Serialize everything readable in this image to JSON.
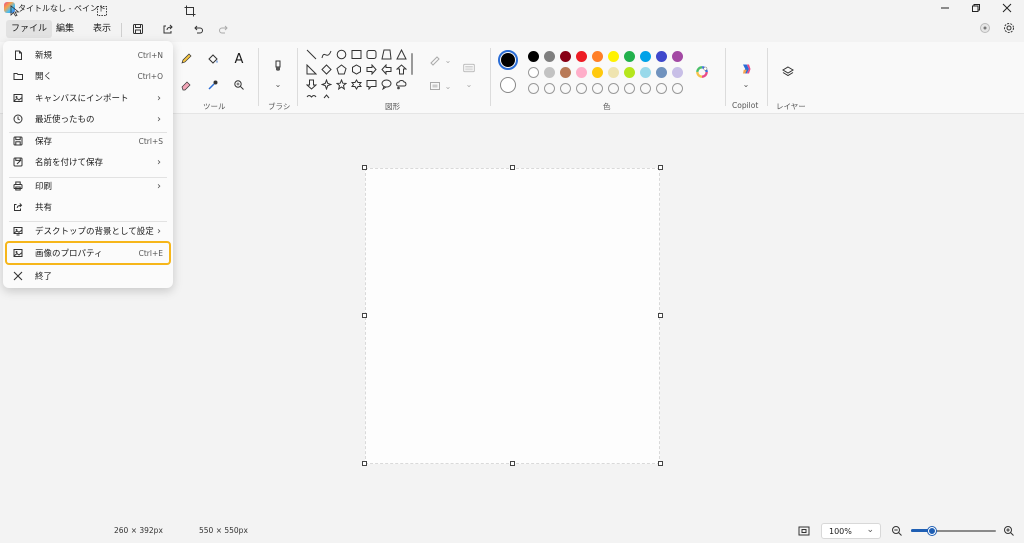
{
  "window": {
    "title": "タイトルなし - ペイント"
  },
  "menubar": {
    "items": [
      {
        "label": "ファイル"
      },
      {
        "label": "編集"
      },
      {
        "label": "表示"
      }
    ]
  },
  "ribbon": {
    "tools_label": "ツール",
    "brush_label": "ブラシ",
    "shapes_label": "図形",
    "colors_label": "色",
    "copilot_label": "Copilot",
    "layers_label": "レイヤー",
    "text_tool": "A",
    "palette": [
      "#000000",
      "#7f7f7f",
      "#880015",
      "#ed1c24",
      "#ff7f27",
      "#fff200",
      "#22b14c",
      "#00a2e8",
      "#3f48cc",
      "#a349a4",
      "#ffffff",
      "#c3c3c3",
      "#b97a57",
      "#ffaec9",
      "#ffc90e",
      "#efe4b0",
      "#b5e61d",
      "#99d9ea",
      "#7092be",
      "#c8bfe7",
      "empty",
      "empty",
      "empty",
      "empty",
      "empty",
      "empty",
      "empty",
      "empty",
      "empty",
      "empty"
    ],
    "primary_color": "#000000",
    "secondary_color": "#ffffff"
  },
  "file_menu": {
    "items": [
      {
        "label": "新規",
        "shortcut": "Ctrl+N",
        "icon": "new-file-icon"
      },
      {
        "label": "開く",
        "shortcut": "Ctrl+O",
        "icon": "folder-icon"
      },
      {
        "label": "キャンバスにインポート",
        "chevron": "›",
        "icon": "import-image-icon"
      },
      {
        "label": "最近使ったもの",
        "chevron": "›",
        "icon": "clock-icon"
      },
      {
        "label": "保存",
        "shortcut": "Ctrl+S",
        "icon": "save-icon"
      },
      {
        "label": "名前を付けて保存",
        "chevron": "›",
        "icon": "save-as-icon"
      },
      {
        "label": "印刷",
        "chevron": "›",
        "icon": "printer-icon"
      },
      {
        "label": "共有",
        "icon": "share-icon"
      },
      {
        "label": "デスクトップの背景として設定",
        "chevron": "›",
        "icon": "desktop-background-icon"
      },
      {
        "label": "画像のプロパティ",
        "shortcut": "Ctrl+E",
        "icon": "image-properties-icon",
        "highlighted": true
      },
      {
        "label": "終了",
        "icon": "close-icon"
      }
    ]
  },
  "statusbar": {
    "cursor_position": "260 × 392px",
    "canvas_size": "550 × 550px",
    "zoom": "100%",
    "zoom_chevron": "⌄"
  },
  "colors": {
    "accent": "#1f5fb4",
    "highlight": "#f6b61a"
  }
}
